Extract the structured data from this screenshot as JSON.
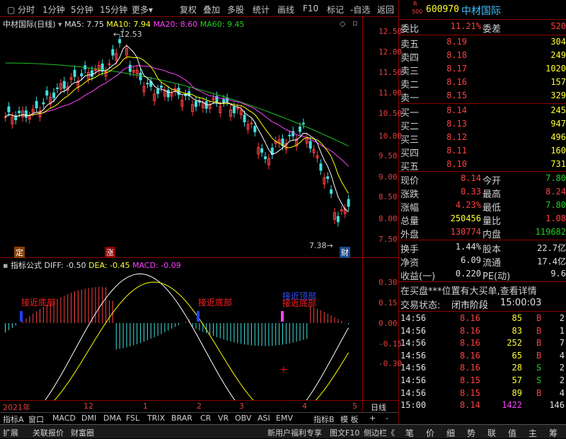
{
  "toolbar": {
    "items": [
      "分时",
      "1分钟",
      "5分钟",
      "15分钟",
      "更多",
      "复权",
      "叠加",
      "多股",
      "统计",
      "画线",
      "F10",
      "标记",
      "-自选",
      "返回"
    ],
    "more_arrow": "▾"
  },
  "chart": {
    "title": "中材国际(日线)",
    "ma5": "MA5: 7.75",
    "ma10": "MA10: 7.94",
    "ma20": "MA20: 8.60",
    "ma60": "MA60: 9.45",
    "high_label": "12.53",
    "low_label": "7.38",
    "yticks": [
      "12.50",
      "12.00",
      "11.50",
      "11.00",
      "10.50",
      "10.00",
      "9.50",
      "9.00",
      "8.50",
      "8.00",
      "7.50"
    ],
    "marker_ding": "定",
    "marker_zhang": "涨",
    "marker_cai": "财",
    "colors": {
      "up": "#ff4040",
      "down": "#40e0e0",
      "ma5": "#ffffff",
      "ma10": "#ffff00",
      "ma20": "#ff40ff",
      "ma60": "#20c020"
    }
  },
  "macd": {
    "title": "指标公式",
    "diff": "DIFF: -0.50",
    "dea": "DEA: -0.45",
    "macd": "MACD: -0.09",
    "yticks": [
      "0.30",
      "0.15",
      "0.00",
      "-0.15",
      "-0.30"
    ],
    "annotation1": "接近底部",
    "annotation2": "接近底部",
    "annotation3": "接近顶部",
    "annotation4": "接近底部"
  },
  "xaxis": {
    "labels": [
      "2021年",
      "12",
      "1",
      "2",
      "3",
      "4",
      "5"
    ],
    "right": "日线"
  },
  "bottom_tabs": [
    "指标A",
    "窗口",
    "MACD",
    "DMI",
    "DMA",
    "FSL",
    "TRIX",
    "BRAR",
    "CR",
    "VR",
    "OBV",
    "ASI",
    "EMV",
    "指标B",
    "模 板",
    "+",
    "-"
  ],
  "bottom_tabs2": [
    "扩展",
    "关联报价",
    "财富圈"
  ],
  "rpanel": {
    "code": "600970",
    "name": "中材国际",
    "r_badge": "R",
    "num_badge": "500",
    "weibi_label": "委比",
    "weibi": "11.21%",
    "weicha_label": "委差",
    "weicha": "520",
    "asks": [
      {
        "l": "卖五",
        "p": "8.19",
        "v": "304"
      },
      {
        "l": "卖四",
        "p": "8.18",
        "v": "249"
      },
      {
        "l": "卖三",
        "p": "8.17",
        "v": "1020"
      },
      {
        "l": "卖二",
        "p": "8.16",
        "v": "157"
      },
      {
        "l": "卖一",
        "p": "8.15",
        "v": "329"
      }
    ],
    "bids": [
      {
        "l": "买一",
        "p": "8.14",
        "v": "245"
      },
      {
        "l": "买二",
        "p": "8.13",
        "v": "947"
      },
      {
        "l": "买三",
        "p": "8.12",
        "v": "496"
      },
      {
        "l": "买四",
        "p": "8.11",
        "v": "160"
      },
      {
        "l": "买五",
        "p": "8.10",
        "v": "731"
      }
    ],
    "q": [
      [
        "现价",
        "8.14",
        "今开",
        "7.80"
      ],
      [
        "涨跌",
        "0.33",
        "最高",
        "8.24"
      ],
      [
        "涨幅",
        "4.23%",
        "最低",
        "7.80"
      ],
      [
        "总量",
        "250456",
        "量比",
        "1.08"
      ],
      [
        "外盘",
        "130774",
        "内盘",
        "119682"
      ]
    ],
    "q2": [
      [
        "换手",
        "1.44%",
        "股本",
        "22.7亿"
      ],
      [
        "净资",
        "6.09",
        "流通",
        "17.4亿"
      ],
      [
        "收益(一)",
        "0.220",
        "PE(动)",
        "9.6"
      ]
    ],
    "notice": "在买盘***位置有大买单,查看详情",
    "status_label": "交易状态:",
    "status": "闭市阶段",
    "status_time": "15:00:03",
    "ticks": [
      [
        "14:56",
        "8.16",
        "85",
        "B",
        "2"
      ],
      [
        "14:56",
        "8.16",
        "83",
        "B",
        "1"
      ],
      [
        "14:56",
        "8.16",
        "252",
        "B",
        "7"
      ],
      [
        "14:56",
        "8.16",
        "65",
        "B",
        "4"
      ],
      [
        "14:56",
        "8.16",
        "28",
        "S",
        "2"
      ],
      [
        "14:56",
        "8.15",
        "57",
        "S",
        "2"
      ],
      [
        "14:56",
        "8.15",
        "89",
        "B",
        "4"
      ],
      [
        "15:00",
        "8.14",
        "1422",
        "",
        "146"
      ]
    ]
  },
  "bottom_bar": {
    "left": "新用户福利专享",
    "f10": "图文F10",
    "side": "侧边栏《",
    "icons": [
      "笔",
      "价",
      "细",
      "势",
      "联",
      "值",
      "主",
      "筹"
    ]
  }
}
